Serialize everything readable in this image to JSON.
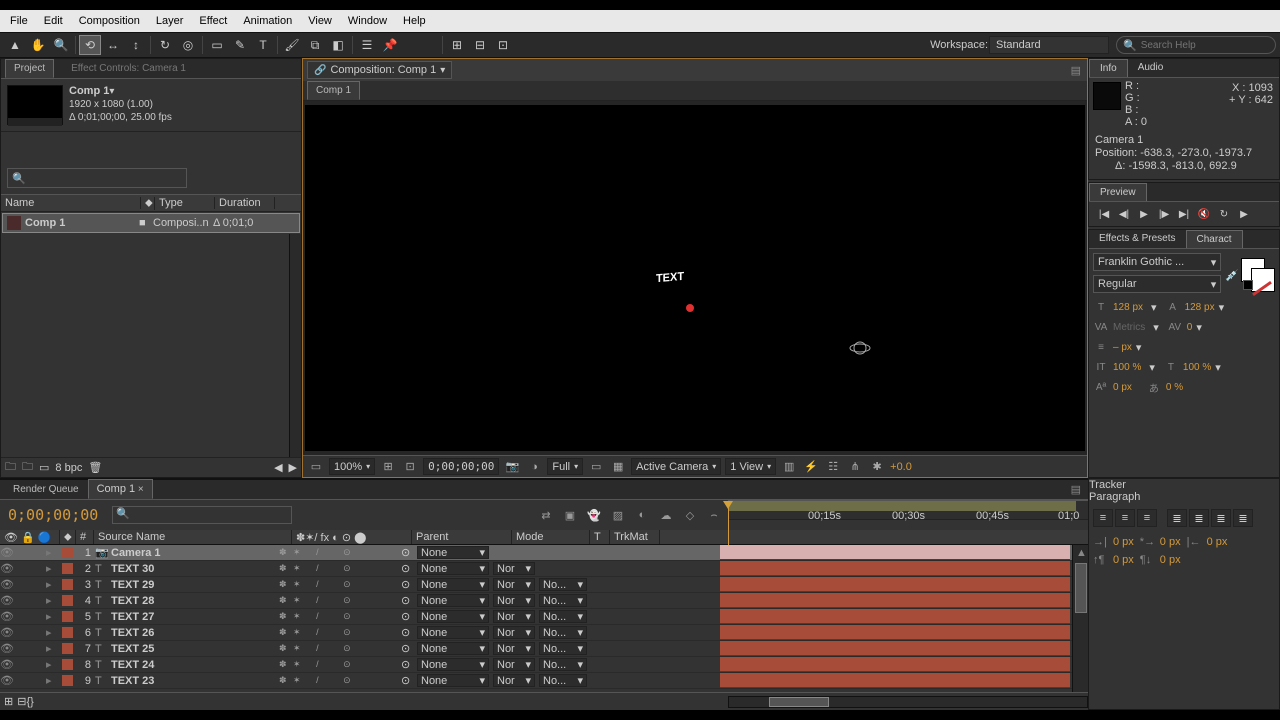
{
  "menu": [
    "File",
    "Edit",
    "Composition",
    "Layer",
    "Effect",
    "Animation",
    "View",
    "Window",
    "Help"
  ],
  "workspace": {
    "label": "Workspace:",
    "value": "Standard"
  },
  "search_help_placeholder": "Search Help",
  "project": {
    "tab": "Project",
    "fx_tab": "Effect Controls: Camera 1",
    "comp_name": "Comp 1",
    "dims": "1920 x 1080 (1.00)",
    "duration": "Δ 0;01;00;00, 25.00 fps",
    "list_headers": {
      "name": "Name",
      "type": "Type",
      "duration": "Duration"
    },
    "items": [
      {
        "name": "Comp 1",
        "type": "Composi..n",
        "duration": "Δ 0;01;0"
      }
    ],
    "bpc": "8 bpc"
  },
  "composition": {
    "panel_label": "Composition: Comp 1",
    "tab": "Comp 1",
    "stage_text": "TEXT",
    "footer": {
      "zoom": "100%",
      "time": "0;00;00;00",
      "res": "Full",
      "view1": "Active Camera",
      "view2": "1 View",
      "exposure": "+0.0"
    }
  },
  "info": {
    "tab1": "Info",
    "tab2": "Audio",
    "r": "R :",
    "g": "G :",
    "b": "B :",
    "a": "A :  0",
    "x": "X : 1093",
    "y": "Y :  642",
    "cam": "Camera 1",
    "pos": "Position: -638.3, -273.0, -1973.7",
    "delta": "Δ: -1598.3, -813.0, 692.9"
  },
  "preview": {
    "tab": "Preview"
  },
  "character": {
    "tab1": "Effects & Presets",
    "tab2": "Charact",
    "font": "Franklin Gothic ...",
    "style": "Regular",
    "size": "128 px",
    "leading": "128 px",
    "tracking": "– px",
    "vscale": "100 %",
    "hscale": "100 %",
    "baseline": "0 px",
    "tsume": "0 %"
  },
  "timeline": {
    "tab1": "Render Queue",
    "tab2": "Comp 1",
    "timecode": "0;00;00;00",
    "col": {
      "idx": "#",
      "src": "Source Name",
      "parent": "Parent",
      "mode": "Mode",
      "t": "T",
      "trkmat": "TrkMat"
    },
    "ruler": [
      "00;15s",
      "00;30s",
      "00;45s",
      "01;0"
    ],
    "layers": [
      {
        "idx": 1,
        "name": "Camera 1",
        "mode": "None",
        "mode2": "",
        "trk": "",
        "cam": true,
        "sel": true
      },
      {
        "idx": 2,
        "name": "TEXT 30",
        "mode": "None",
        "mode2": "Nor",
        "trk": ""
      },
      {
        "idx": 3,
        "name": "TEXT 29",
        "mode": "None",
        "mode2": "Nor",
        "trk": "No..."
      },
      {
        "idx": 4,
        "name": "TEXT 28",
        "mode": "None",
        "mode2": "Nor",
        "trk": "No..."
      },
      {
        "idx": 5,
        "name": "TEXT 27",
        "mode": "None",
        "mode2": "Nor",
        "trk": "No..."
      },
      {
        "idx": 6,
        "name": "TEXT 26",
        "mode": "None",
        "mode2": "Nor",
        "trk": "No..."
      },
      {
        "idx": 7,
        "name": "TEXT 25",
        "mode": "None",
        "mode2": "Nor",
        "trk": "No..."
      },
      {
        "idx": 8,
        "name": "TEXT 24",
        "mode": "None",
        "mode2": "Nor",
        "trk": "No..."
      },
      {
        "idx": 9,
        "name": "TEXT 23",
        "mode": "None",
        "mode2": "Nor",
        "trk": "No..."
      }
    ]
  },
  "tracker": {
    "tab1": "Tracker",
    "tab2": "Paragraph",
    "indent": "0 px"
  }
}
